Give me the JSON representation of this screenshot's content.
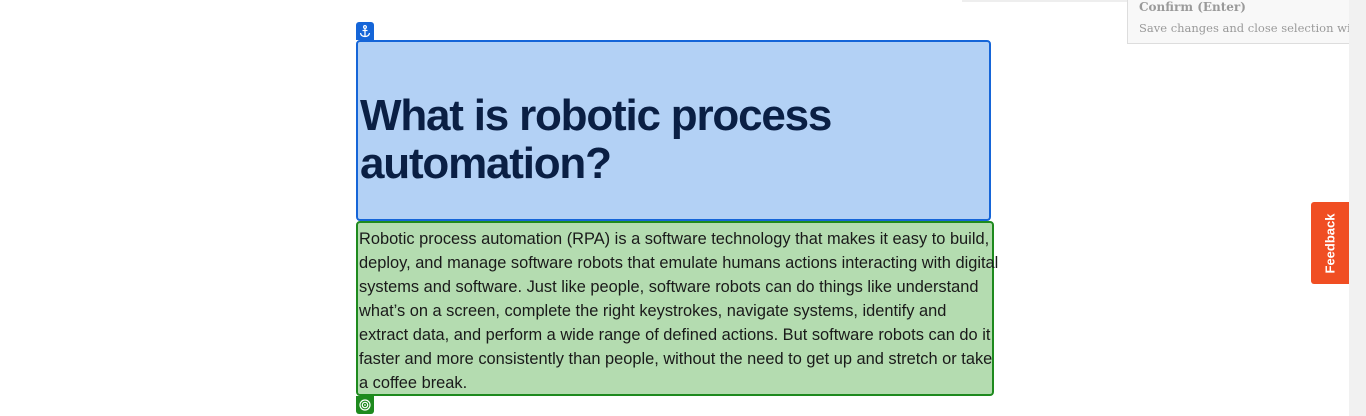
{
  "tooltip": {
    "title": "Confirm (Enter)",
    "description": "Save changes and close selection wizard."
  },
  "content": {
    "heading": "What is robotic process automation?",
    "body": "Robotic process automation (RPA) is a software technology that makes it easy to build, deploy, and manage software robots that emulate humans actions interacting with digital systems and software. Just like people, software robots can do things like understand what’s on a screen, complete the right keystrokes, navigate systems, identify and extract data, and perform a wide range of defined actions. But software robots can do it faster and more consistently than people, without the need to get up and stretch or take a coffee break."
  },
  "feedback": {
    "label": "Feedback"
  },
  "icons": {
    "anchor": "anchor-icon",
    "target": "target-icon"
  },
  "colors": {
    "anchor_highlight": "#b3d1f5",
    "anchor_border": "#1565d8",
    "target_highlight": "#b4dcb0",
    "target_border": "#1e8a1e",
    "feedback": "#f04e23"
  }
}
